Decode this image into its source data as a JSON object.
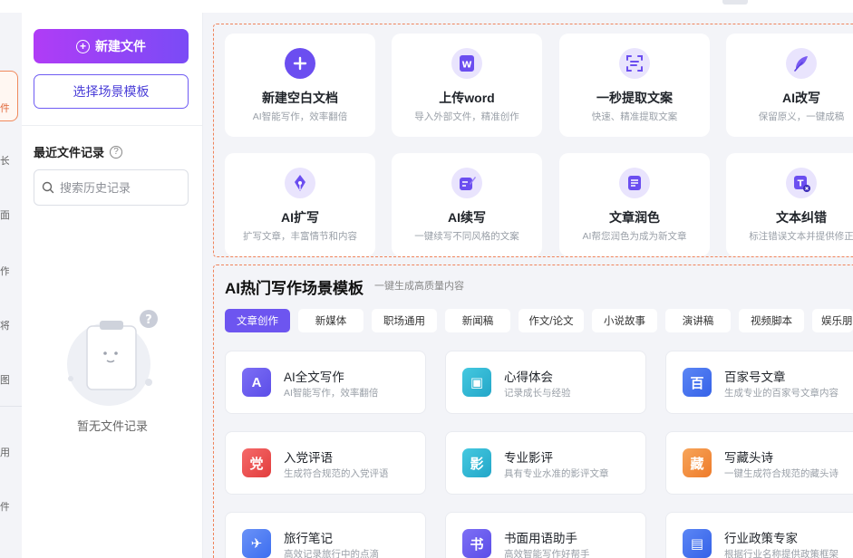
{
  "sidebar": {
    "new_file_label": "新建文件",
    "template_label": "选择场景模板",
    "recent_title": "最近文件记录",
    "search_placeholder": "搜索历史记录",
    "empty_text": "暂无文件记录",
    "rail_chars": [
      "件",
      "长",
      "面",
      "作",
      "将",
      "图",
      "用",
      "件"
    ]
  },
  "features": [
    {
      "title": "新建空白文档",
      "subtitle": "AI智能写作，效率翻倍",
      "icon": "plus-icon",
      "color": "#6b4ef0"
    },
    {
      "title": "上传word",
      "subtitle": "导入外部文件，精准创作",
      "icon": "word-icon",
      "color": "#6b4ef0"
    },
    {
      "title": "一秒提取文案",
      "subtitle": "快速、精准提取文案",
      "icon": "scan-text-icon",
      "color": "#6b4ef0"
    },
    {
      "title": "AI改写",
      "subtitle": "保留原义，一键成稿",
      "icon": "feather-icon",
      "color": "#6b4ef0"
    },
    {
      "title": "AI扩写",
      "subtitle": "扩写文章，丰富情节和内容",
      "icon": "pen-nib-icon",
      "color": "#6b4ef0"
    },
    {
      "title": "AI续写",
      "subtitle": "一键续写不同风格的文案",
      "icon": "edit-doc-icon",
      "color": "#6b4ef0"
    },
    {
      "title": "文章润色",
      "subtitle": "AI帮您润色为成为新文章",
      "icon": "doc-list-icon",
      "color": "#6b4ef0"
    },
    {
      "title": "文本纠错",
      "subtitle": "标注错误文本并提供修正",
      "icon": "text-fix-icon",
      "color": "#6b4ef0"
    }
  ],
  "templates_section": {
    "title": "AI热门写作场景模板",
    "subtitle": "一键生成高质量内容",
    "tabs": [
      "文章创作",
      "新媒体",
      "职场通用",
      "新闻稿",
      "作文/论文",
      "小说故事",
      "演讲稿",
      "视频脚本",
      "娱乐朋"
    ],
    "active_tab": "文章创作",
    "items": [
      {
        "title": "AI全文写作",
        "subtitle": "AI智能写作，效率翻倍",
        "icon": "ai-write-icon",
        "glyph": "A",
        "color": "#6e63f2"
      },
      {
        "title": "心得体会",
        "subtitle": "记录成长与经验",
        "icon": "notebook-icon",
        "glyph": "▣",
        "color": "#2bb8d4"
      },
      {
        "title": "百家号文章",
        "subtitle": "生成专业的百家号文章内容",
        "icon": "baijiahao-icon",
        "glyph": "百",
        "color": "#3d6ff2"
      },
      {
        "title": "入党评语",
        "subtitle": "生成符合规范的入党评语",
        "icon": "party-icon",
        "glyph": "党",
        "color": "#ef4b4b"
      },
      {
        "title": "专业影评",
        "subtitle": "具有专业水准的影评文章",
        "icon": "film-icon",
        "glyph": "影",
        "color": "#2bb8d4"
      },
      {
        "title": "写藏头诗",
        "subtitle": "一键生成符合规范的藏头诗",
        "icon": "poem-icon",
        "glyph": "藏",
        "color": "#f28a3c"
      },
      {
        "title": "旅行笔记",
        "subtitle": "高效记录旅行中的点滴",
        "icon": "travel-icon",
        "glyph": "✈",
        "color": "#4a7cf5"
      },
      {
        "title": "书面用语助手",
        "subtitle": "高效智能写作好帮手",
        "icon": "book-icon",
        "glyph": "书",
        "color": "#6e63f2"
      },
      {
        "title": "行业政策专家",
        "subtitle": "根据行业名称提供政策框架",
        "icon": "policy-icon",
        "glyph": "▤",
        "color": "#3d6ff2"
      }
    ]
  }
}
